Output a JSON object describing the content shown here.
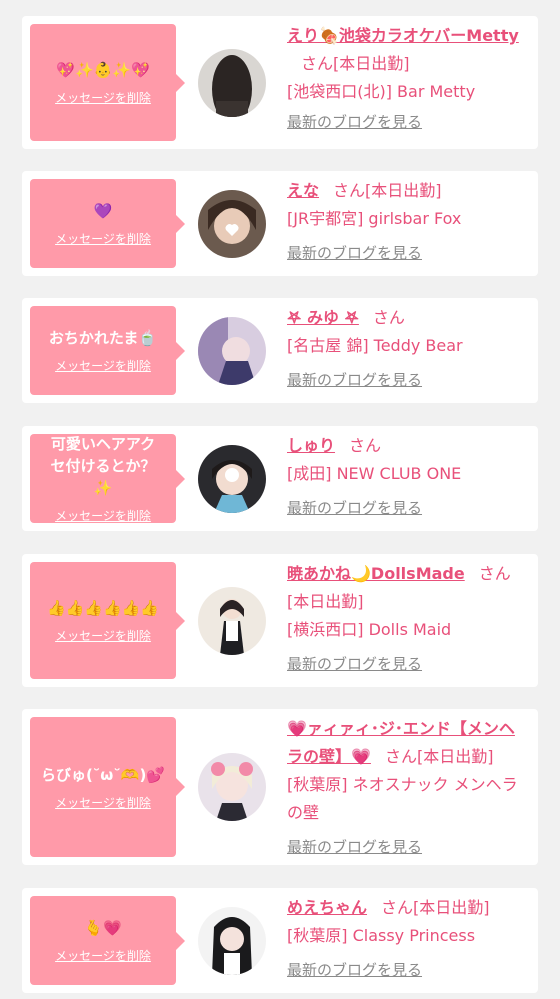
{
  "delete_label": "メッセージを削除",
  "san_label": "さん",
  "blog_label": "最新のブログを見る",
  "cards": [
    {
      "message": "💖✨👶✨💖",
      "name": "えり🍖池袋カラオケバーMetty",
      "status": "[本日出勤]",
      "store": "[池袋西口(北)] Bar Metty"
    },
    {
      "message": "💜",
      "name": "えな",
      "status": "[本日出勤]",
      "store": "[JR宇都宮] girlsbar Fox"
    },
    {
      "message": "おちかれたま🍵",
      "name": "𖤐 みゆ 𖤐",
      "status": "",
      "store": "[名古屋 錦] Teddy Bear"
    },
    {
      "message": "可愛いヘアアクセ付けるとか？✨",
      "name": "しゅり",
      "status": "",
      "store": "[成田] NEW CLUB ONE"
    },
    {
      "message": "👍👍👍👍👍👍",
      "name": "暁あかね🌙DollsMade",
      "status": "[本日出勤]",
      "store": "[横浜西口] Dolls Maid"
    },
    {
      "message": "らびゅ(˘ω˘🫶)💕",
      "name": "💗ァィァィ･ジ･エンド【メンヘラの壁】💗",
      "status": "[本日出勤]",
      "store": "[秋葉原] ネオスナック メンヘラの壁"
    },
    {
      "message": "🫰💗",
      "name": "めえちゃん",
      "status": "[本日出勤]",
      "store": "[秋葉原] Classy Princess"
    }
  ]
}
